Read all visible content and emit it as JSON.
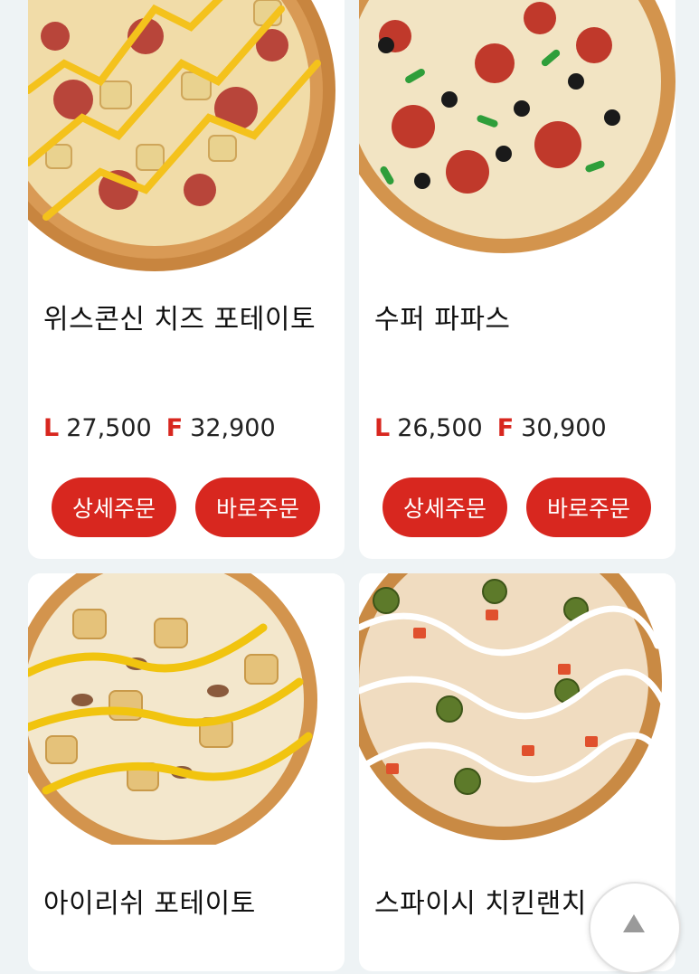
{
  "menu": {
    "items": [
      {
        "name": "위스콘신 치즈 포테이토",
        "price_l_tag": "L",
        "price_l": "27,500",
        "price_f_tag": "F",
        "price_f": "32,900",
        "detail_label": "상세주문",
        "direct_label": "바로주문"
      },
      {
        "name": "수퍼 파파스",
        "price_l_tag": "L",
        "price_l": "26,500",
        "price_f_tag": "F",
        "price_f": "30,900",
        "detail_label": "상세주문",
        "direct_label": "바로주문"
      },
      {
        "name": "아이리쉬 포테이토"
      },
      {
        "name": "스파이시 치킨랜치"
      }
    ]
  },
  "scroll_top": {
    "icon": "triangle-up-icon"
  },
  "colors": {
    "accent": "#d8271f",
    "background": "#eef3f5",
    "card": "#ffffff"
  }
}
